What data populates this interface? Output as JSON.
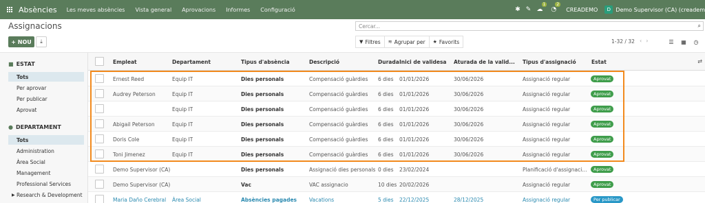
{
  "nav": {
    "app_title": "Absències",
    "menu": [
      "Les meves absències",
      "Vista general",
      "Aprovacions",
      "Informes",
      "Configuració"
    ],
    "chat_count": "1",
    "activity_count": "2",
    "company": "CREADEMO",
    "user_initial": "D",
    "user": "Demo Supervisor (CA) (creadem"
  },
  "control": {
    "title": "Assignacions",
    "new_label": "NOU",
    "search_placeholder": "Cercar...",
    "filters_label": "Filtres",
    "groupby_label": "Agrupar per",
    "favorites_label": "Favorits",
    "pager": "1-32 / 32"
  },
  "sidebar": {
    "estat_title": "ESTAT",
    "estat_items": [
      "Tots",
      "Per aprovar",
      "Per publicar",
      "Aprovat"
    ],
    "dept_title": "DEPARTAMENT",
    "dept_items": [
      "Tots",
      "Administration",
      "Àrea Social",
      "Management",
      "Professional Services",
      "Research & Development"
    ]
  },
  "table": {
    "columns": [
      "Empleat",
      "Departament",
      "Tipus d'absència",
      "Descripció",
      "Durada",
      "Inici de validesa",
      "Aturada de la valid...",
      "Tipus d'assignació",
      "Estat"
    ],
    "rows": [
      {
        "empleat": "Ernest Reed",
        "dept": "Equip IT",
        "tipus": "Dies personals",
        "desc": "Compensació guàrdies",
        "durada": "6 dies",
        "inici": "01/01/2026",
        "aturada": "30/06/2026",
        "assig": "Assignació regular",
        "estat": "Aprovat"
      },
      {
        "empleat": "Audrey Peterson",
        "dept": "Equip IT",
        "tipus": "Dies personals",
        "desc": "Compensació guàrdies",
        "durada": "6 dies",
        "inici": "01/01/2026",
        "aturada": "30/06/2026",
        "assig": "Assignació regular",
        "estat": "Aprovat"
      },
      {
        "empleat": "",
        "dept": "Equip IT",
        "tipus": "Dies personals",
        "desc": "Compensació guàrdies",
        "durada": "6 dies",
        "inici": "01/01/2026",
        "aturada": "30/06/2026",
        "assig": "Assignació regular",
        "estat": "Aprovat"
      },
      {
        "empleat": "Abigail Peterson",
        "dept": "Equip IT",
        "tipus": "Dies personals",
        "desc": "Compensació guàrdies",
        "durada": "6 dies",
        "inici": "01/01/2026",
        "aturada": "30/06/2026",
        "assig": "Assignació regular",
        "estat": "Aprovat"
      },
      {
        "empleat": "Doris Cole",
        "dept": "Equip IT",
        "tipus": "Dies personals",
        "desc": "Compensació guàrdies",
        "durada": "6 dies",
        "inici": "01/01/2026",
        "aturada": "30/06/2026",
        "assig": "Assignació regular",
        "estat": "Aprovat"
      },
      {
        "empleat": "Toni Jimenez",
        "dept": "Equip IT",
        "tipus": "Dies personals",
        "desc": "Compensació guàrdies",
        "durada": "6 dies",
        "inici": "01/01/2026",
        "aturada": "30/06/2026",
        "assig": "Assignació regular",
        "estat": "Aprovat"
      },
      {
        "empleat": "Demo Supervisor (CA)",
        "dept": "",
        "tipus": "Dies personals",
        "desc": "Assignació dies personals",
        "durada": "0 dies",
        "inici": "23/02/2024",
        "aturada": "",
        "assig": "Planificació d'assignaci...",
        "estat": "Aprovat"
      },
      {
        "empleat": "Demo Supervisor (CA)",
        "dept": "",
        "tipus": "Vac",
        "desc": "VAC assignacio",
        "durada": "10 dies",
        "inici": "20/02/2026",
        "aturada": "",
        "assig": "Assignació regular",
        "estat": "Aprovat"
      },
      {
        "empleat": "Maria Daño Cerebral",
        "dept": "Àrea Social",
        "tipus": "Absències pagades",
        "desc": "Vacations",
        "durada": "5 dies",
        "inici": "22/12/2025",
        "aturada": "28/12/2025",
        "assig": "Assignació regular",
        "estat": "Per publicar"
      }
    ]
  },
  "colors": {
    "nav": "#5a7c5b",
    "approved": "#3f9d4b",
    "to_publish": "#2a98c7",
    "highlight": "#f28a1d"
  }
}
